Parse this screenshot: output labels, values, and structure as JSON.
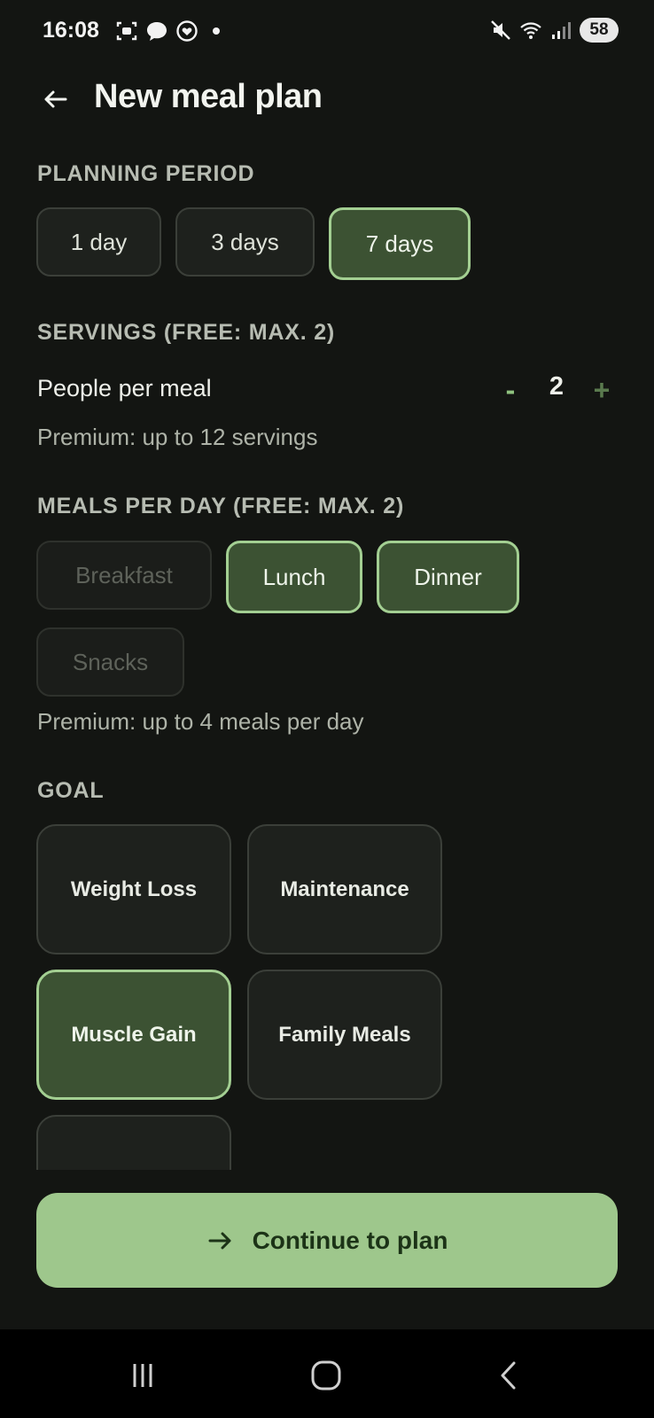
{
  "status_bar": {
    "time": "16:08",
    "battery": "58",
    "icons_left": [
      "screenshot-icon",
      "chat-bubble-icon",
      "heart-chat-icon",
      "notification-dot"
    ],
    "icons_right": [
      "mute-icon",
      "wifi-icon",
      "signal-icon",
      "battery-icon"
    ]
  },
  "header": {
    "title": "New meal plan",
    "back_icon": "arrow-left-icon"
  },
  "planning_period": {
    "label": "PLANNING PERIOD",
    "options": [
      {
        "label": "1 day",
        "selected": false
      },
      {
        "label": "3 days",
        "selected": false
      },
      {
        "label": "7 days",
        "selected": true
      }
    ]
  },
  "servings": {
    "label": "SERVINGS (FREE: MAX. 2)",
    "row_label": "People per meal",
    "minus": "-",
    "value": "2",
    "plus": "+",
    "note": "Premium: up to 12 servings"
  },
  "meals": {
    "label": "MEALS PER DAY (FREE: MAX. 2)",
    "options": [
      {
        "label": "Breakfast",
        "state": "disabled"
      },
      {
        "label": "Lunch",
        "state": "selected"
      },
      {
        "label": "Dinner",
        "state": "selected"
      },
      {
        "label": "Snacks",
        "state": "disabled"
      }
    ],
    "note": "Premium: up to 4 meals per day"
  },
  "goal": {
    "label": "GOAL",
    "options": [
      {
        "label": "Weight Loss",
        "selected": false
      },
      {
        "label": "Maintenance",
        "selected": false
      },
      {
        "label": "Muscle Gain",
        "selected": true
      },
      {
        "label": "Family Meals",
        "selected": false
      }
    ]
  },
  "continue_button": {
    "label": "Continue to plan",
    "icon": "arrow-right-icon"
  },
  "colors": {
    "background": "#131512",
    "accent": "#9ec78c",
    "selected_fill": "#3c5233",
    "selected_border": "#a3cf92"
  },
  "nav_bar": {
    "icons": [
      "recent-apps-icon",
      "home-icon",
      "back-icon"
    ]
  }
}
